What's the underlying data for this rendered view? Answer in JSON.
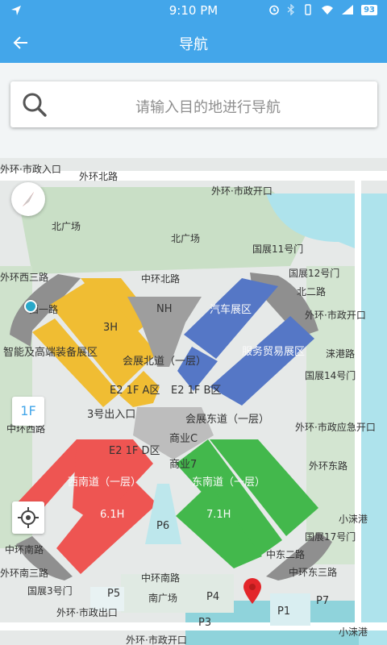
{
  "status": {
    "time": "9:10 PM",
    "battery": "93"
  },
  "appbar": {
    "title": "导航"
  },
  "search": {
    "placeholder": "请输入目的地进行导航"
  },
  "floor": "1F",
  "colors": {
    "accent": "#43a6ea",
    "hall_north": "#f0bd33",
    "hall_east": "#5577c6",
    "hall_south": "#43b84c",
    "hall_west": "#ee5552",
    "hub": "#9e9e9e"
  },
  "map": {
    "roads": {
      "outer_ring_entrance": "外环·市政入口",
      "outer_north": "外环北路",
      "outer_gate_top": "外环·市政开口",
      "north_plaza_1": "北广场",
      "north_plaza_2": "北广场",
      "gate_11": "国展11号门",
      "outer_west3": "外环西三路",
      "middle_north": "中环北路",
      "gate_12": "国展12号门",
      "north2": "北二路",
      "west1": "西一路",
      "outer_gate_right": "外环·市政开口",
      "lai_gang_road": "涞港路",
      "gate_14": "国展14号门",
      "middle_west": "中环西路",
      "outer_emergency": "外环·市政应急开口",
      "outer_east": "外环东路",
      "xiao_lai_gang": "小涞港",
      "gate_17": "国展17号门",
      "south_left": "中环南路",
      "outer_south3": "外环南三路",
      "east2": "中东二路",
      "outer_east3": "中环东三路",
      "gate_3": "国展3号门",
      "middle_south": "中环南路",
      "south_plaza": "南广场",
      "outer_exit": "外环·市政出口",
      "outer_bottom": "外环·市政开口",
      "xiao_lai_gang_2": "小涞港"
    },
    "halls": {
      "h3": "3H",
      "smart_mfg": "智能及高端装备展区",
      "nh": "NH",
      "auto": "汽车展区",
      "service_trade": "服务贸易展区",
      "north_avenue": "会展北道（一层）",
      "e2a": "E2 1F A区",
      "e2b": "E2 1F B区",
      "exit3": "3号出入口",
      "east_avenue": "会展东道（一层）",
      "e2d": "E2 1F D区",
      "business_c": "商业C",
      "business_7": "商业7",
      "southwest_avenue": "西南道（一层）",
      "southeast_avenue": "东南道（一层）",
      "h61": "6.1H",
      "h71": "7.1H",
      "p6": "P6",
      "p5": "P5",
      "p4": "P4",
      "p3": "P3",
      "p1": "P1",
      "p7": "P7"
    }
  }
}
